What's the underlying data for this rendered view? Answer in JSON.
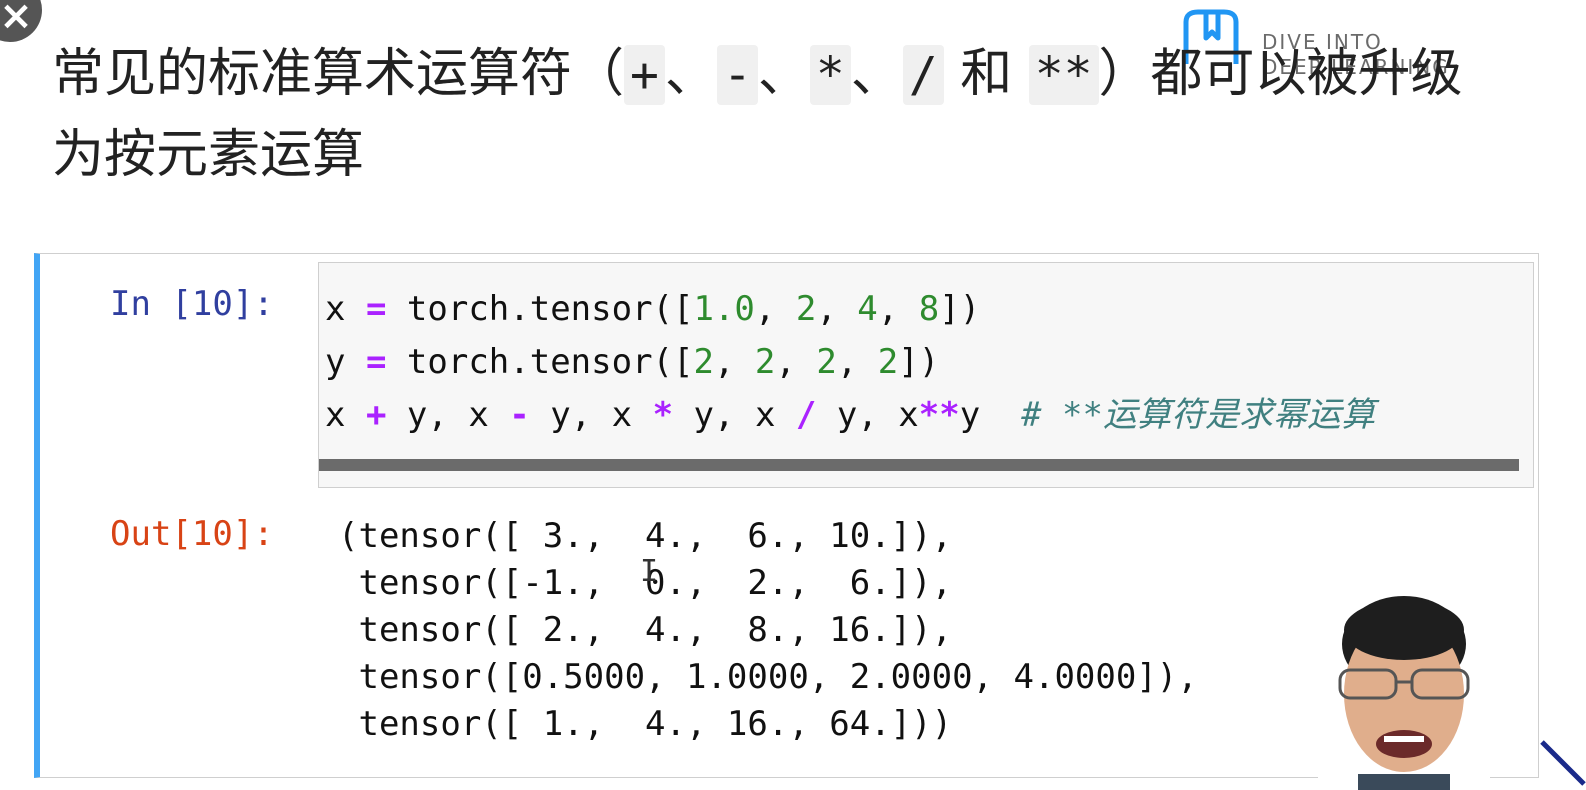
{
  "headline": {
    "part1": "常见的标准算术运算符（",
    "op_plus": "+",
    "sep1": "、",
    "op_minus": "-",
    "sep2": "、",
    "op_mul": "*",
    "sep3": "、",
    "op_div": "/",
    "and_word": " 和 ",
    "op_pow": "**",
    "part2": "）都可以被升级为按元素运算"
  },
  "logo": {
    "text_line1": "DIVE INTO",
    "text_line2": "DEEP LEARNING",
    "icon": "book-icon"
  },
  "close_button": {
    "icon": "close-icon",
    "label": "×"
  },
  "cell": {
    "in_prompt": "In [10]:",
    "code": {
      "line1": {
        "a": "x ",
        "op": "=",
        "b": " torch.tensor([",
        "n1": "1.0",
        "c1": ", ",
        "n2": "2",
        "c2": ", ",
        "n3": "4",
        "c3": ", ",
        "n4": "8",
        "end": "])"
      },
      "line2": {
        "a": "y ",
        "op": "=",
        "b": " torch.tensor([",
        "n1": "2",
        "c1": ", ",
        "n2": "2",
        "c2": ", ",
        "n3": "2",
        "c3": ", ",
        "n4": "2",
        "end": "])"
      },
      "line3": {
        "x1": "x ",
        "plus": "+",
        "y1": " y, x ",
        "minus": "-",
        "y2": " y, x ",
        "mul": "*",
        "y3": " y, x ",
        "div": "/",
        "y4": " y, x",
        "pow": "**",
        "y5": "y  ",
        "comment": "# **运算符是求幂运算"
      }
    },
    "out_prompt": "Out[10]:",
    "output_lines": [
      "(tensor([ 3.,  4.,  6., 10.]),",
      " tensor([-1.,  0.,  2.,  6.]),",
      " tensor([ 2.,  4.,  8., 16.]),",
      " tensor([0.5000, 1.0000, 2.0000, 4.0000]),",
      " tensor([ 1.,  4., 16., 64.]))"
    ]
  },
  "colors": {
    "accent_border": "#42a5f5",
    "in_prompt": "#303f9f",
    "out_prompt": "#d84315",
    "operator": "#aa22ff",
    "number": "#2e8b2e",
    "comment": "#408080"
  }
}
